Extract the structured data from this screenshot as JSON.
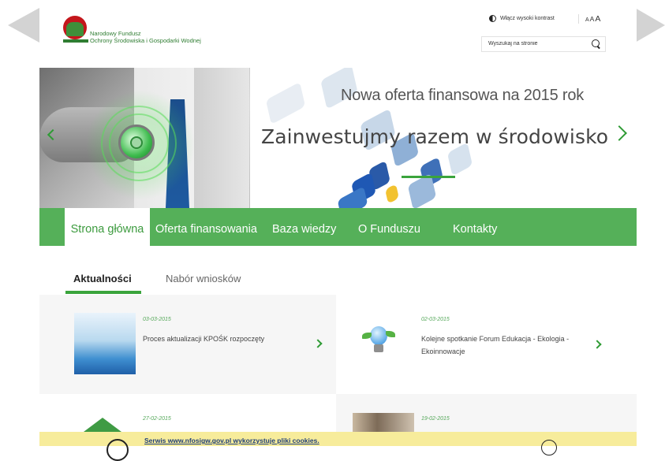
{
  "header": {
    "logo_line1": "Narodowy Fundusz",
    "logo_line2": "Ochrony Środowiska i Gospodarki Wodnej",
    "contrast_label": "Włącz wysoki kontrast",
    "font_small": "A",
    "font_medium": "A",
    "font_large": "A",
    "search_placeholder": "Wyszukaj na stronie"
  },
  "hero": {
    "subtitle": "Nowa oferta finansowa na 2015 rok",
    "title": "Zainwestujmy razem w środowisko"
  },
  "nav": {
    "items": [
      {
        "label": "Strona główna"
      },
      {
        "label": "Oferta finansowania"
      },
      {
        "label": "Baza wiedzy"
      },
      {
        "label": "O Funduszu"
      },
      {
        "label": "Kontakty"
      }
    ]
  },
  "tabs": [
    {
      "label": "Aktualności"
    },
    {
      "label": "Nabór wniosków"
    }
  ],
  "news": [
    {
      "date": "03-03-2015",
      "title": "Proces aktualizacji KPOŚK rozpoczęty",
      "thumb_icon": "water-splash-image"
    },
    {
      "date": "02-03-2015",
      "title": "Kolejne spotkanie Forum Edukacja - Ekologia - Ekoinnowacje",
      "thumb_icon": "lightbulb-image"
    },
    {
      "date": "27-02-2015",
      "title": "",
      "thumb_icon": "green-house-image"
    },
    {
      "date": "19-02-2015",
      "title": "",
      "thumb_icon": "people-photo-image"
    }
  ],
  "cookie": {
    "text": "Serwis www.nfosigw.gov.pl wykorzystuje pliki cookies."
  },
  "colors": {
    "brand_green": "#55b059",
    "accent_green": "#3aa43c",
    "cookie_bg": "#f7ec9b"
  }
}
